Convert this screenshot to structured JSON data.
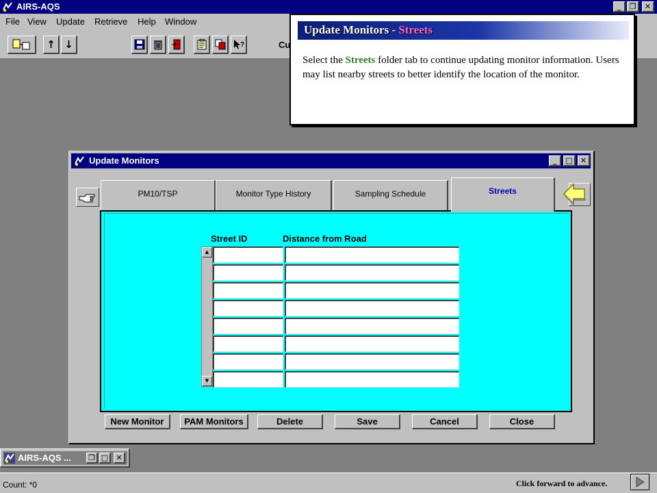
{
  "app": {
    "title": "AIRS-AQS",
    "window_controls": {
      "minimize": "_",
      "restore": "❐",
      "close": "✕"
    }
  },
  "menu": {
    "items": [
      "File",
      "View",
      "Update",
      "Retrieve",
      "Help",
      "Window"
    ]
  },
  "toolbar": {
    "truncated_label": "Cu"
  },
  "callout": {
    "title_prefix": "Update Monitors - ",
    "title_highlight": "Streets",
    "body_before": "Select the ",
    "body_highlight": "Streets",
    "body_after": " folder tab to continue updating monitor information.  Users may list nearby streets to better identify the location of the monitor."
  },
  "dialog": {
    "title": "Update Monitors",
    "tabs": [
      {
        "label": "PM10/TSP",
        "active": false
      },
      {
        "label": "Monitor Type History",
        "active": false
      },
      {
        "label": "Sampling Schedule",
        "active": false
      },
      {
        "label": "Streets",
        "active": true
      }
    ],
    "columns": [
      "Street ID",
      "Distance from Road"
    ],
    "row_count": 8,
    "buttons": [
      "New Monitor",
      "PAM Monitors",
      "Delete",
      "Save",
      "Cancel",
      "Close"
    ]
  },
  "minimized_window": {
    "title": "AIRS-AQS ..."
  },
  "status": {
    "count": "Count: *0",
    "advance_hint": "Click forward to advance."
  },
  "colors": {
    "titlebar": "#000080",
    "panel": "#00ffff",
    "face": "#c0c0c0",
    "desktop": "#808080",
    "callout_highlight": "#2e7d2e"
  }
}
